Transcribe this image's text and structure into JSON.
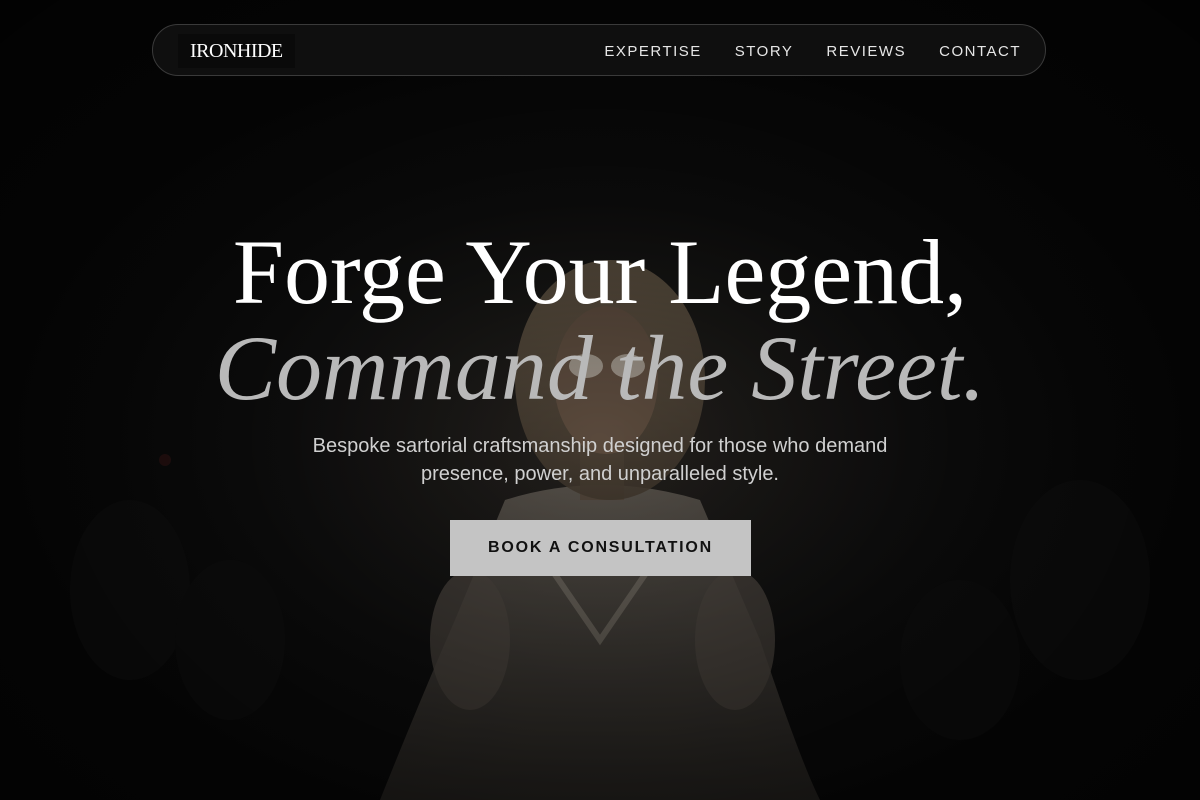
{
  "header": {
    "logo": "IRONHIDE",
    "nav": [
      {
        "label": "EXPERTISE"
      },
      {
        "label": "STORY"
      },
      {
        "label": "REVIEWS"
      },
      {
        "label": "CONTACT"
      }
    ]
  },
  "hero": {
    "headline_line1": "Forge Your Legend,",
    "headline_line2": "Command the Street.",
    "subtitle": "Bespoke sartorial craftsmanship designed for those who demand presence, power, and unparalleled style.",
    "cta_label": "BOOK A CONSULTATION"
  },
  "colors": {
    "background": "#0d0d0d",
    "headline_primary": "#ffffff",
    "headline_secondary": "#b9b9b9",
    "cta_background": "#c4c4c4",
    "cta_text": "#111111"
  }
}
